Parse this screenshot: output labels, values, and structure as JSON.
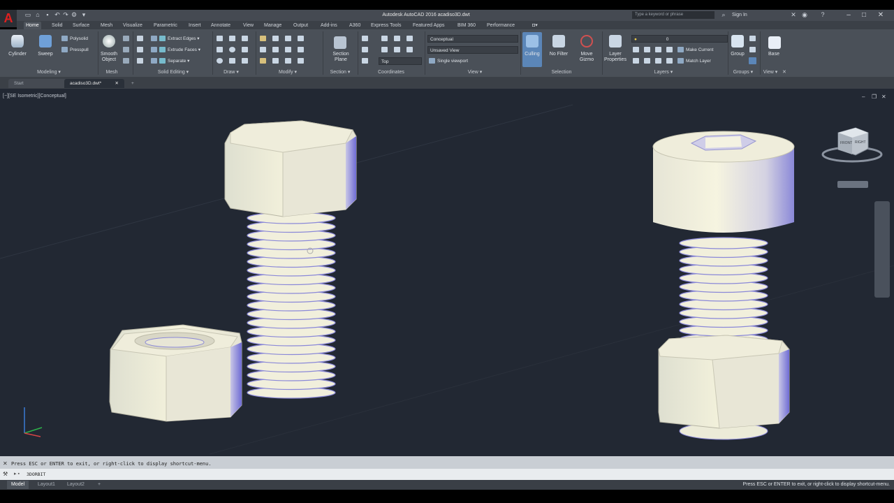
{
  "title_bar": {
    "window_title": "Autodesk AutoCAD 2016    acadiso3D.dwt",
    "search_placeholder": "Type a keyword or phrase",
    "sign_in": "Sign In",
    "app_logo": "A"
  },
  "ribbon_tabs": [
    "Home",
    "Solid",
    "Surface",
    "Mesh",
    "Visualize",
    "Parametric",
    "Insert",
    "Annotate",
    "View",
    "Manage",
    "Output",
    "Add-ins",
    "A360",
    "Express Tools",
    "Featured Apps",
    "BIM 360",
    "Performance"
  ],
  "ribbon": {
    "modeling": {
      "title": "Modeling ▾",
      "cylinder": "Cylinder",
      "sweep": "Sweep",
      "polysolid": "Polysolid",
      "presspull": "Presspull"
    },
    "mesh": {
      "title": "Mesh",
      "smooth_object": "Smooth\nObject"
    },
    "solid_editing": {
      "title": "Solid Editing ▾",
      "extract_edges": "Extract Edges ▾",
      "extrude_faces": "Extrude Faces ▾",
      "separate": "Separate ▾"
    },
    "draw": {
      "title": "Draw ▾"
    },
    "modify": {
      "title": "Modify ▾"
    },
    "section": {
      "title": "Section ▾",
      "section_plane": "Section\nPlane"
    },
    "coordinates": {
      "title": "Coordinates",
      "top": "Top"
    },
    "view": {
      "title": "View ▾",
      "visual_style": "Conceptual",
      "saved_view": "Unsaved View",
      "viewport": "Single viewport"
    },
    "selection": {
      "title": "Selection",
      "culling": "Culling",
      "no_filter": "No Filter",
      "move_gizmo": "Move\nGizmo"
    },
    "layers": {
      "title": "Layers ▾",
      "layer_properties": "Layer\nProperties",
      "layer_value": "0",
      "make_current": "Make Current",
      "match_layer": "Match Layer"
    },
    "groups": {
      "title": "Groups ▾",
      "group": "Group"
    },
    "view2": {
      "title": "View ▾",
      "base": "Base"
    }
  },
  "file_tabs": [
    "Start",
    "acadiso3D.dwt*"
  ],
  "viewport": {
    "label": "[−][SE Isometric][Conceptual]",
    "viewcube_front": "FRONT",
    "viewcube_right": "RIGHT",
    "wcs": "WCS"
  },
  "command_line": {
    "history": "Press ESC or ENTER to exit, or right-click to display shortcut-menu.",
    "input": "3DORBIT"
  },
  "layout_tabs": [
    "Model",
    "Layout1",
    "Layout2"
  ],
  "status_text": "Press ESC or ENTER to exit, or right-click to display shortcut-menu.",
  "colors": {
    "viewport_bg": "#222833",
    "ribbon_bg": "#4a5058",
    "model_face": "#f2f0da",
    "model_shade": "#8a88d8"
  }
}
